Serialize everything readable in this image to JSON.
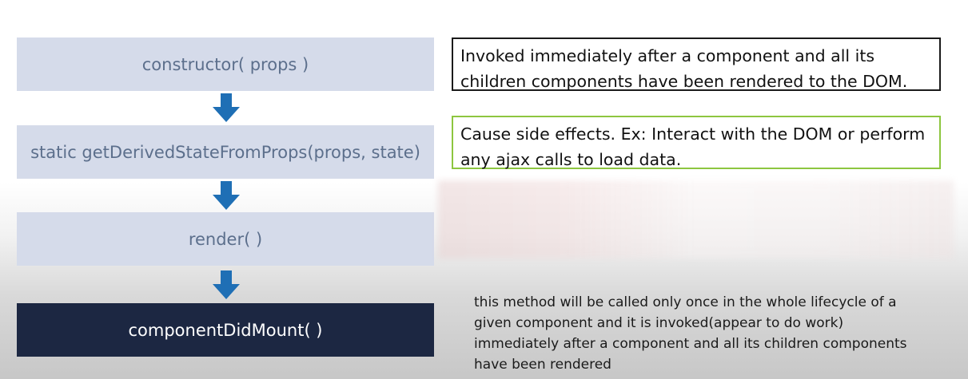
{
  "flow": {
    "steps": [
      {
        "label": "constructor( props )"
      },
      {
        "label": "static getDerivedStateFromProps(props, state)"
      },
      {
        "label": "render( )"
      },
      {
        "label": "componentDidMount( )"
      }
    ],
    "colors": {
      "light_box": "#d5dbea",
      "dark_box": "#1c2742",
      "arrow": "#1f6fb5",
      "light_text": "#5c6f8c"
    }
  },
  "notes": {
    "invoked": {
      "lines": [
        "Invoked immediately after a component and all its",
        "children components have been rendered to the DOM."
      ],
      "border_color": "#1a1a1a"
    },
    "side_effects": {
      "lines": [
        "Cause side effects. Ex: Interact with the DOM or perform",
        "any ajax calls to load data."
      ],
      "border_color": "#8dc63f"
    }
  },
  "caption": {
    "lines": [
      "this method will be called only once in the whole lifecycle of a",
      "given component and it is invoked(appear to do work)",
      "immediately after a component and all its children components",
      "have been rendered"
    ]
  }
}
